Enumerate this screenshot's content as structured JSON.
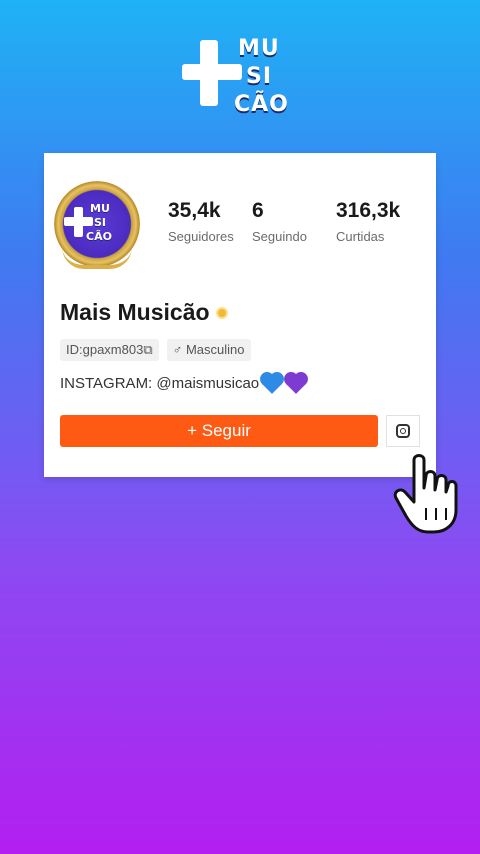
{
  "logo": {
    "line1": "MU",
    "line2": "SI",
    "line3": "CÃO"
  },
  "profile": {
    "avatar_lines": [
      "MU",
      "SI",
      "CÃO"
    ],
    "stats": [
      {
        "value": "35,4k",
        "label": "Seguidores"
      },
      {
        "value": "6",
        "label": "Seguindo"
      },
      {
        "value": "316,3k",
        "label": "Curtidas"
      }
    ],
    "name": "Mais Musicão",
    "id_chip": "ID:gpaxm803⧉",
    "gender_chip": "♂ Masculino",
    "bio": "INSTAGRAM: @maismusicao",
    "follow_button": "+ Seguir",
    "instagram_icon": "instagram-icon"
  },
  "colors": {
    "accent": "#ff5a14",
    "heart_blue": "#2f8ae6",
    "heart_purple": "#7e3bd1"
  }
}
